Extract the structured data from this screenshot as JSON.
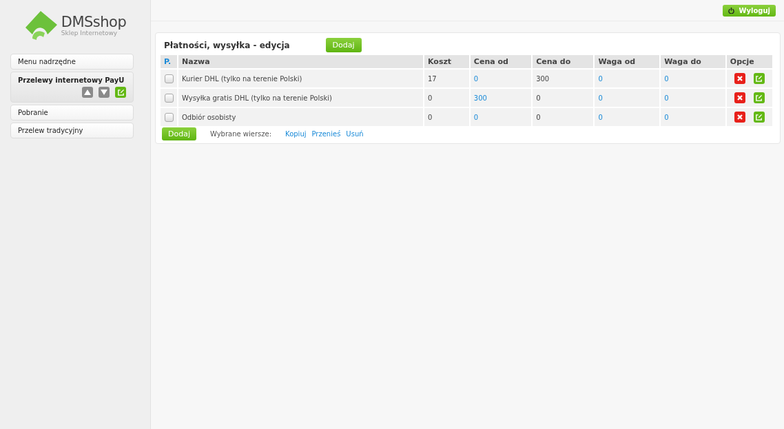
{
  "logo": {
    "name": "DMSshop",
    "tagline": "Sklep Internetowy"
  },
  "sidebar": {
    "items": [
      {
        "label": "Menu nadrzędne",
        "selected": false
      },
      {
        "label": "Przelewy internetowy PayU",
        "selected": true
      },
      {
        "label": "Pobranie",
        "selected": false
      },
      {
        "label": "Przelew tradycyjny",
        "selected": false
      }
    ]
  },
  "topbar": {
    "logout": "Wyloguj"
  },
  "panel": {
    "title": "Płatności, wysyłka - edycja",
    "add_button": "Dodaj"
  },
  "table": {
    "columns": [
      {
        "label": "P.",
        "kind": "check"
      },
      {
        "label": "Nazwa",
        "kind": "text"
      },
      {
        "label": "Koszt",
        "kind": "text"
      },
      {
        "label": "Cena od",
        "kind": "link"
      },
      {
        "label": "Cena do",
        "kind": "text"
      },
      {
        "label": "Waga od",
        "kind": "link"
      },
      {
        "label": "Waga do",
        "kind": "link"
      },
      {
        "label": "Opcje",
        "kind": "options"
      }
    ],
    "rows": [
      {
        "checked": false,
        "cells": [
          "",
          "Kurier DHL (tylko na terenie Polski)",
          "17",
          "0",
          "300",
          "0",
          "0",
          ""
        ]
      },
      {
        "checked": false,
        "cells": [
          "",
          "Wysyłka gratis DHL (tylko na terenie Polski)",
          "0",
          "300",
          "0",
          "0",
          "0",
          ""
        ]
      },
      {
        "checked": false,
        "cells": [
          "",
          "Odbiór osobisty",
          "0",
          "0",
          "0",
          "0",
          "0",
          ""
        ]
      }
    ]
  },
  "footer": {
    "add_button": "Dodaj",
    "selected_label": "Wybrane wiersze:",
    "actions": [
      "Kopiuj",
      "Przenieś",
      "Usuń"
    ]
  }
}
